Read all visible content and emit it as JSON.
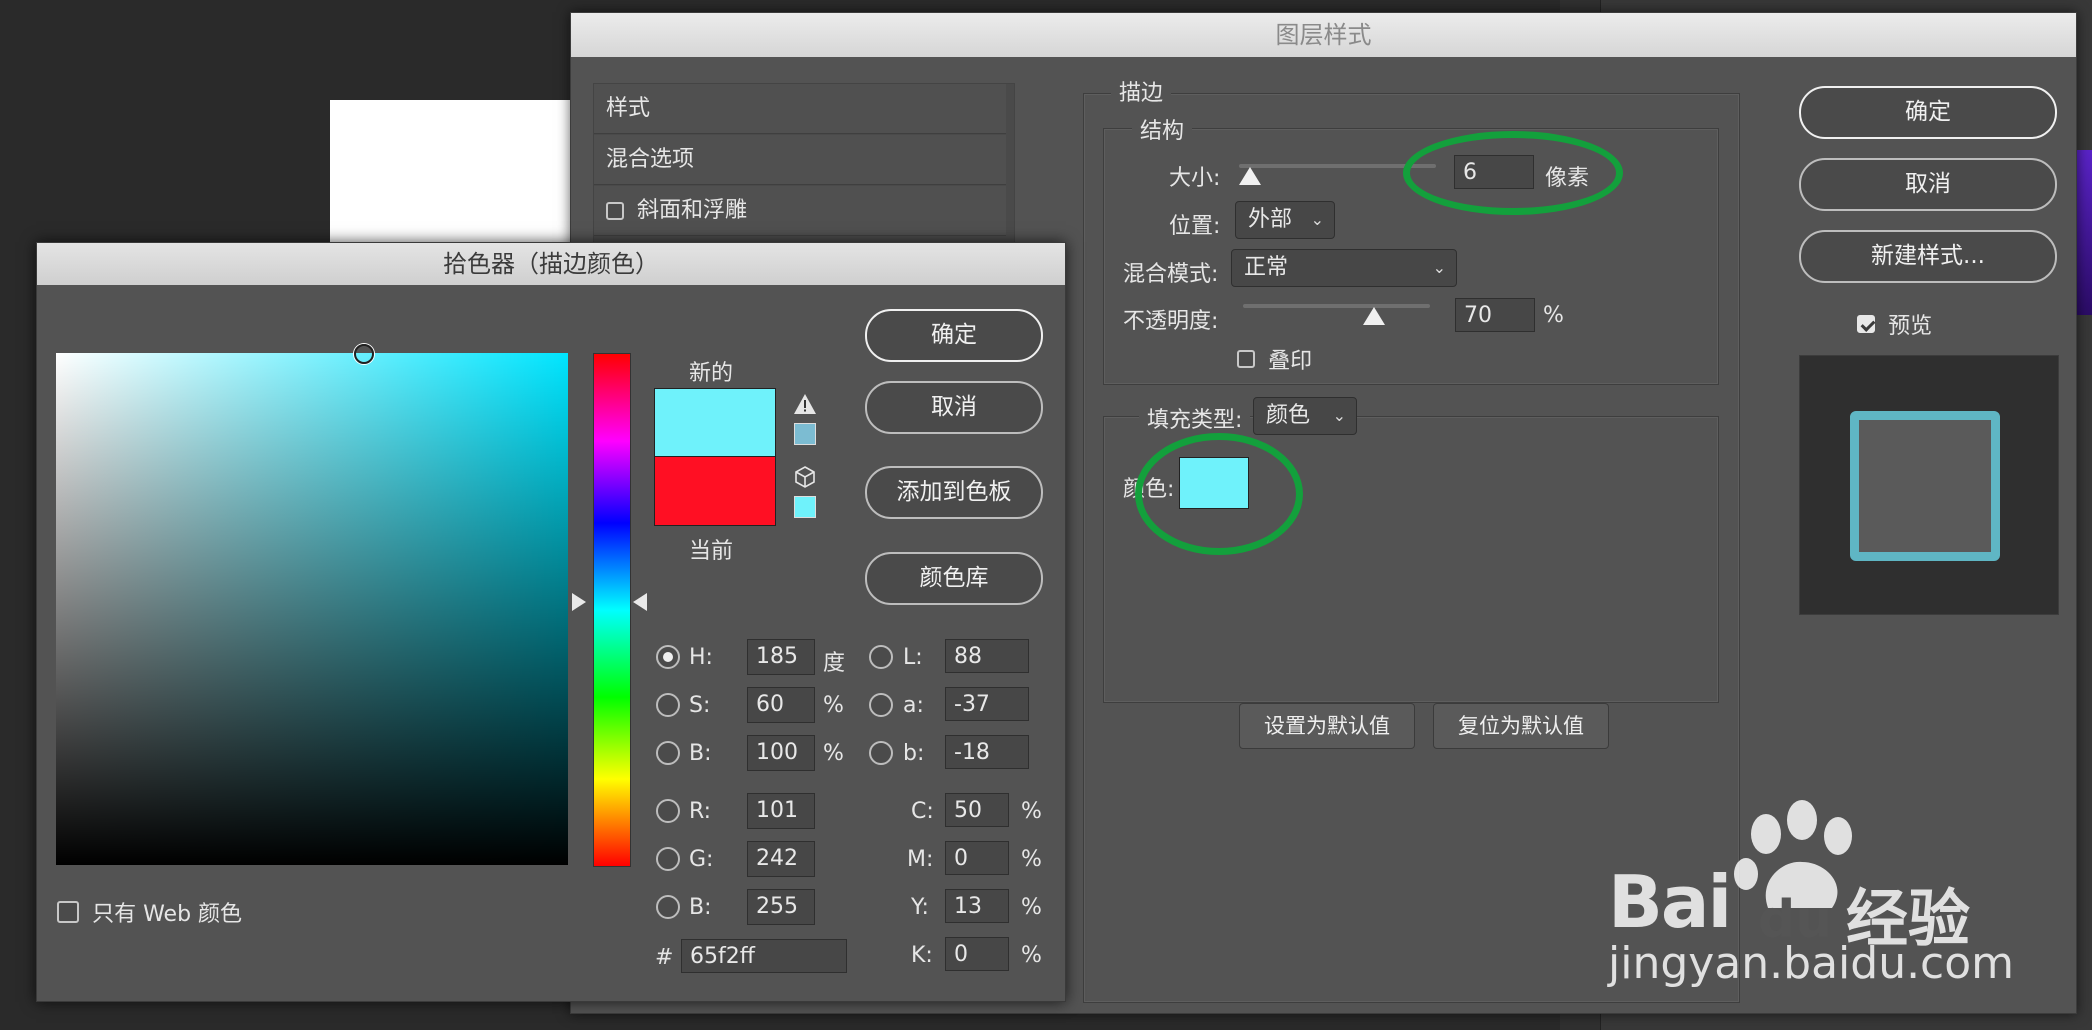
{
  "layer_style": {
    "title": "图层样式",
    "style_list": [
      {
        "label": "样式"
      },
      {
        "label": "混合选项"
      },
      {
        "label": "斜面和浮雕",
        "checkbox": false
      }
    ],
    "stroke": {
      "group_title": "描边",
      "structure_title": "结构",
      "size_label": "大小:",
      "size_value": "6",
      "size_unit": "像素",
      "position_label": "位置:",
      "position_value": "外部",
      "blend_label": "混合模式:",
      "blend_value": "正常",
      "opacity_label": "不透明度:",
      "opacity_value": "70",
      "opacity_unit": "%",
      "opacity_level": 0.7,
      "overprint_label": "叠印",
      "fill_type_label": "填充类型:",
      "fill_type_value": "颜色",
      "color_label": "颜色:",
      "color_hex": "#6ff2fb",
      "set_default": "设置为默认值",
      "reset_default": "复位为默认值"
    },
    "buttons": {
      "ok": "确定",
      "cancel": "取消",
      "new_style": "新建样式..."
    },
    "preview_label": "预览",
    "preview_checked": true
  },
  "color_picker": {
    "title": "拾色器（描边颜色）",
    "new_label": "新的",
    "current_label": "当前",
    "new_color": "#6ff2fb",
    "current_color": "#ff0f23",
    "buttons": {
      "ok": "确定",
      "cancel": "取消",
      "add_swatch": "添加到色板",
      "color_library": "颜色库"
    },
    "hsb": {
      "h_label": "H:",
      "h_value": "185",
      "h_unit": "度",
      "s_label": "S:",
      "s_value": "60",
      "s_unit": "%",
      "b_label": "B:",
      "b_value": "100",
      "b_unit": "%"
    },
    "lab": {
      "l_label": "L:",
      "l_value": "88",
      "a_label": "a:",
      "a_value": "-37",
      "b_label": "b:",
      "b_value": "-18"
    },
    "rgb": {
      "r_label": "R:",
      "r_value": "101",
      "g_label": "G:",
      "g_value": "242",
      "b_label": "B:",
      "b_value": "255"
    },
    "cmyk": {
      "c_label": "C:",
      "c_value": "50",
      "m_label": "M:",
      "m_value": "0",
      "y_label": "Y:",
      "y_value": "13",
      "k_label": "K:",
      "k_value": "0",
      "unit": "%"
    },
    "hex_label": "#",
    "hex_value": "65f2ff",
    "web_only_label": "只有 Web 颜色",
    "icons": [
      "warning-icon",
      "cube-icon"
    ]
  },
  "watermark": {
    "brand": "Bai",
    "brand_du": "du",
    "brand_cn": "经验",
    "url": "jingyan.baidu.com"
  },
  "colors": {
    "highlight": "#13a03c",
    "dialog_bg": "#535353"
  }
}
